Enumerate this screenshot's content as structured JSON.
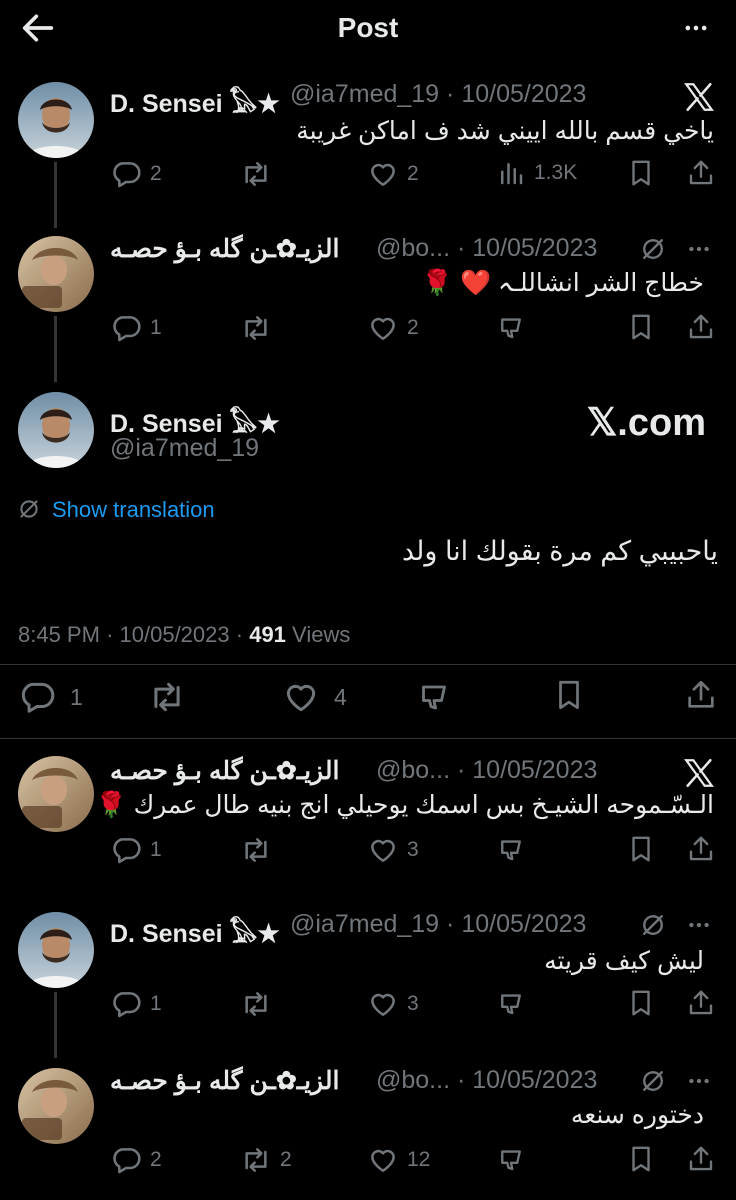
{
  "header": {
    "title": "Post"
  },
  "posts": [
    {
      "name": "D. Sensei 𓅃★",
      "handle": "@ia7med_19",
      "date": "10/05/2023",
      "text": "ياخي قسم بالله اييني شد ف اماكن غريبة",
      "replies": "2",
      "reposts": "",
      "likes": "2",
      "views": "1.3K"
    },
    {
      "name": "الزيـ✿ـن گله بـؤ حصـه",
      "handle": "@bo...",
      "date": "10/05/2023",
      "text": "خطاج الشر انشاللـہ ❤️ 🌹",
      "replies": "1",
      "reposts": "",
      "likes": "2"
    }
  ],
  "main_post": {
    "name": "D. Sensei 𓅃★",
    "handle": "@ia7med_19",
    "watermark": "𝕏.com",
    "show_translation": "Show translation",
    "text": "ياحبيبي كم مرة بقولك انا ولد",
    "time": "8:45 PM",
    "date": "10/05/2023",
    "views_count": "491",
    "views_label": "Views",
    "replies": "1",
    "reposts": "",
    "likes": "4"
  },
  "replies": [
    {
      "name": "الزيـ✿ـن گله بـؤ حصـه",
      "handle": "@bo...",
      "date": "10/05/2023",
      "text": "الـسّـموحه الشيـخ بس اسمك يوحيلي انج بنيه طال عمرك 🌹",
      "replies": "1",
      "reposts": "",
      "likes": "3"
    },
    {
      "name": "D. Sensei 𓅃★",
      "handle": "@ia7med_19",
      "date": "10/05/2023",
      "text": "ليش كيف قريته",
      "replies": "1",
      "reposts": "",
      "likes": "3"
    },
    {
      "name": "الزيـ✿ـن گله بـؤ حصـه",
      "handle": "@bo...",
      "date": "10/05/2023",
      "text": "دختوره سنعه",
      "replies": "2",
      "reposts": "2",
      "likes": "12"
    }
  ],
  "separator": "·",
  "colors": {
    "background": "#000000",
    "text": "#e7e9ea",
    "muted": "#71767b",
    "link": "#1d9bf0",
    "divider": "#2f3336"
  },
  "icons": [
    "back-arrow-icon",
    "more-icon",
    "x-logo-icon",
    "reply-icon",
    "repost-icon",
    "like-icon",
    "views-icon",
    "bookmark-icon",
    "share-icon",
    "translate-icon",
    "downvote-icon"
  ]
}
